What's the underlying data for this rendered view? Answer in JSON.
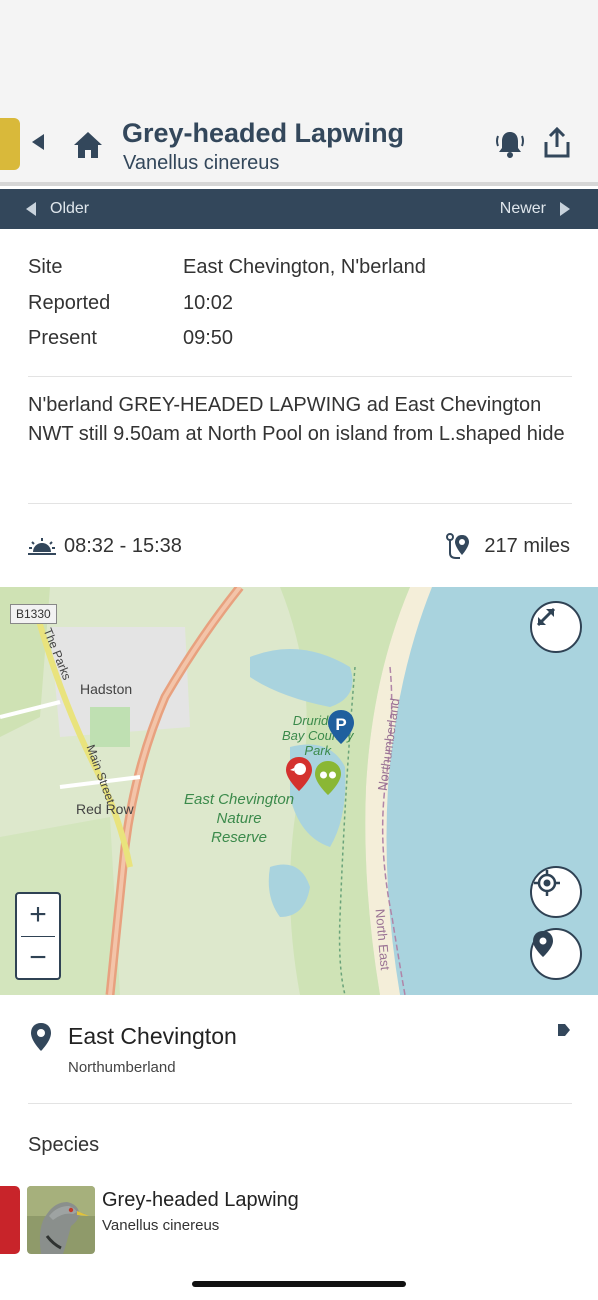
{
  "header": {
    "title": "Grey-headed Lapwing",
    "subtitle": "Vanellus cinereus",
    "accent_color": "#d9b93a",
    "icons": [
      "back-arrow-icon",
      "home-icon",
      "bell-icon",
      "share-icon"
    ]
  },
  "nav": {
    "older_label": "Older",
    "newer_label": "Newer"
  },
  "details": {
    "rows": [
      {
        "key": "Site",
        "value": "East Chevington, N'berland"
      },
      {
        "key": "Reported",
        "value": "10:02"
      },
      {
        "key": "Present",
        "value": "09:50"
      }
    ],
    "message": "N'berland GREY-HEADED LAPWING ad East Chevington NWT still 9.50am at North Pool on island from L.shaped hide"
  },
  "sun": {
    "times": "08:32 - 15:38",
    "icon": "sunrise-icon"
  },
  "distance": {
    "value": "217 miles",
    "icon": "route-pin-icon"
  },
  "map": {
    "road_label": "B1330",
    "labels": {
      "the_parks": "The Parks",
      "hadston": "Hadston",
      "main_street": "Main Street",
      "red_row": "Red Row",
      "druridge": "Druridge Bay Country Park",
      "druridge_l1": "Druridge",
      "druridge_l2": "Bay Country",
      "druridge_l3": "Park",
      "reserve_l1": "East Chevington",
      "reserve_l2": "Nature",
      "reserve_l3": "Reserve",
      "northumberland": "Northumberland",
      "north_east": "North East"
    },
    "zoom_in": "+",
    "zoom_out": "−"
  },
  "location": {
    "name": "East Chevington",
    "county": "Northumberland"
  },
  "species": {
    "heading": "Species",
    "name": "Grey-headed Lapwing",
    "scientific": "Vanellus cinereus",
    "rarity_color": "#c8242a"
  }
}
